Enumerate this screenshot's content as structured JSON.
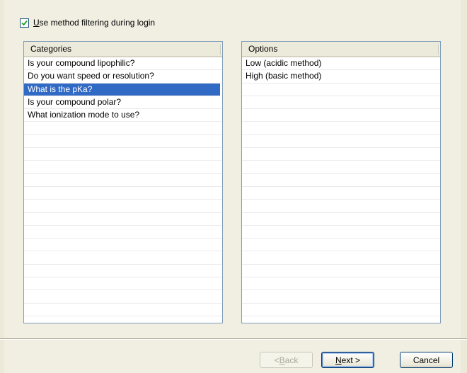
{
  "filter": {
    "checked": true,
    "label_mnemonic": "U",
    "label_rest": "se method filtering during login"
  },
  "categories": {
    "header": "Categories",
    "items": [
      "Is your compound lipophilic?",
      "Do you want speed or resolution?",
      "What is the pKa?",
      "Is your compound polar?",
      "What ionization mode to use?"
    ],
    "selected_index": 2
  },
  "options": {
    "header": "Options",
    "items": [
      "Low (acidic method)",
      "High (basic method)"
    ]
  },
  "buttons": {
    "back": {
      "prefix": "< ",
      "mnemonic": "B",
      "rest": "ack",
      "enabled": false
    },
    "next": {
      "mnemonic": "N",
      "rest": "ext >",
      "enabled": true
    },
    "cancel": {
      "label": "Cancel",
      "enabled": true
    }
  },
  "colors": {
    "selection": "#316ac5",
    "border": "#7f9db9",
    "window_bg": "#f1efe2"
  }
}
